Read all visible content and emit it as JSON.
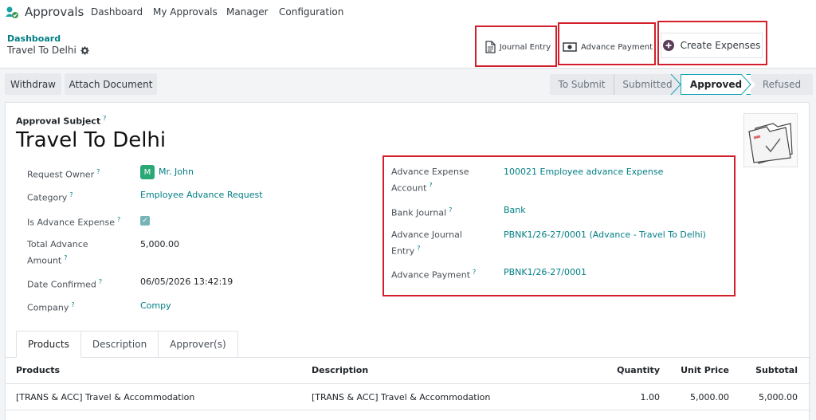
{
  "app": {
    "name": "Approvals",
    "menu": [
      "Dashboard",
      "My Approvals",
      "Manager",
      "Configuration"
    ]
  },
  "breadcrumb": {
    "parent": "Dashboard",
    "current": "Travel To Delhi"
  },
  "smart_buttons": {
    "journal_entry": "Journal Entry",
    "advance_payment": "Advance Payment",
    "create_expenses": "Create Expenses"
  },
  "actions": {
    "withdraw": "Withdraw",
    "attach_document": "Attach Document"
  },
  "stages": [
    "To Submit",
    "Submitted",
    "Approved",
    "Refused"
  ],
  "active_stage": "Approved",
  "form": {
    "subject_label": "Approval Subject",
    "subject": "Travel To Delhi",
    "help_mark": "?",
    "left": {
      "request_owner_label": "Request Owner",
      "request_owner_initial": "M",
      "request_owner": "Mr. John",
      "category_label": "Category",
      "category": "Employee Advance Request",
      "is_advance_label": "Is Advance Expense",
      "is_advance_check": "✓",
      "total_advance_label_1": "Total Advance",
      "total_advance_label_2": "Amount",
      "total_advance": "5,000.00",
      "date_confirmed_label": "Date Confirmed",
      "date_confirmed": "06/05/2026 13:42:19",
      "company_label": "Company",
      "company": "Compy"
    },
    "right": {
      "adv_exp_account_label_1": "Advance Expense",
      "adv_exp_account_label_2": "Account",
      "adv_exp_account": "100021 Employee advance Expense",
      "bank_journal_label": "Bank Journal",
      "bank_journal": "Bank",
      "adv_journal_entry_label_1": "Advance Journal",
      "adv_journal_entry_label_2": "Entry",
      "adv_journal_entry": "PBNK1/26-27/0001 (Advance - Travel To Delhi)",
      "adv_payment_label": "Advance Payment",
      "adv_payment": "PBNK1/26-27/0001"
    }
  },
  "tabs": [
    "Products",
    "Description",
    "Approver(s)"
  ],
  "table": {
    "columns": [
      "Products",
      "Description",
      "Quantity",
      "Unit Price",
      "Subtotal"
    ],
    "rows": [
      [
        "[TRANS & ACC] Travel & Accommodation",
        "[TRANS & ACC] Travel & Accommodation",
        "1.00",
        "5,000.00",
        "5,000.00"
      ]
    ]
  },
  "colors": {
    "accent": "#017e84",
    "highlight_box": "#d21f2b",
    "avatar": "#2aa876"
  }
}
